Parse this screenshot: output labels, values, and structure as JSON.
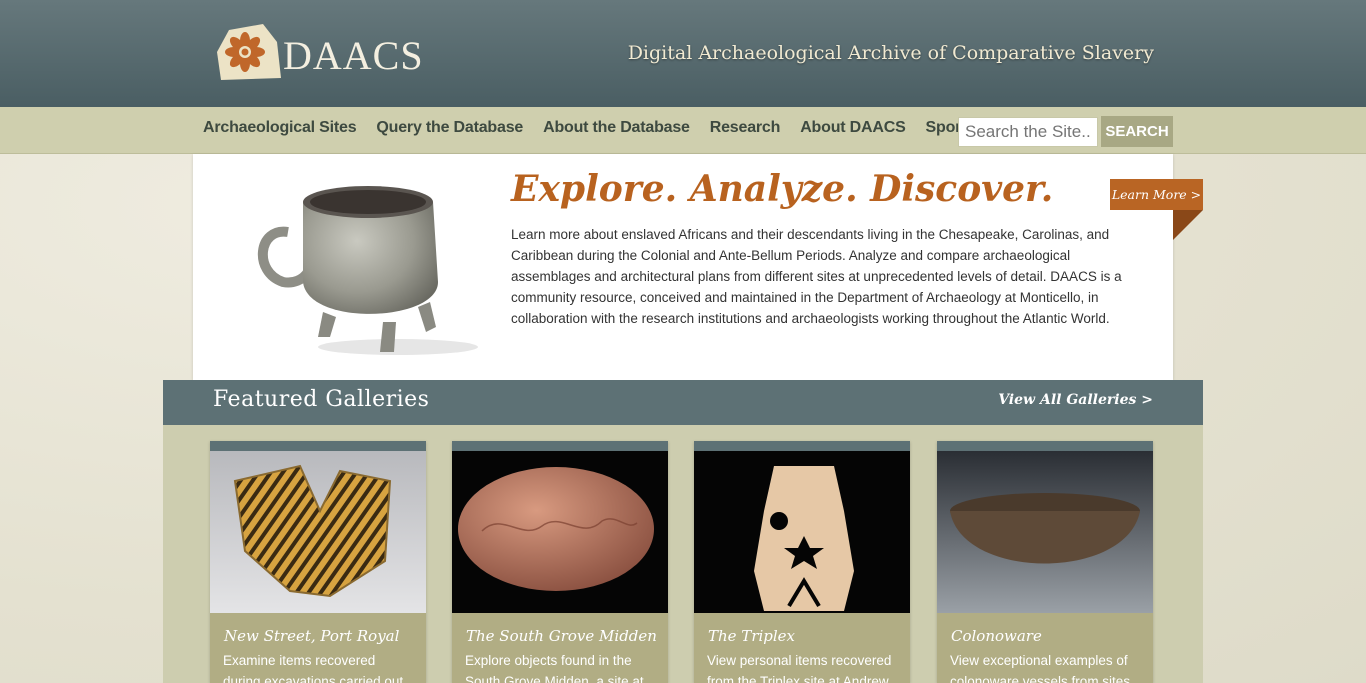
{
  "header": {
    "logo_text": "DAACS",
    "tagline": "Digital Archaeological Archive of Comparative Slavery"
  },
  "nav": {
    "items": [
      {
        "label": "Archaeological Sites"
      },
      {
        "label": "Query the Database"
      },
      {
        "label": "About the Database"
      },
      {
        "label": "Research"
      },
      {
        "label": "About DAACS"
      },
      {
        "label": "Sponsors"
      }
    ],
    "search_placeholder": "Search the Site..",
    "search_button": "SEARCH"
  },
  "hero": {
    "title": "Explore. Analyze. Discover.",
    "body": "Learn more about enslaved Africans and their descendants living in the Chesapeake, Carolinas, and Caribbean during the Colonial and Ante-Bellum Periods. Analyze and compare archaeological assemblages and architectural plans from different sites at unprecedented levels of detail. DAACS is a community resource, conceived and maintained in the Department of Archaeology at Monticello, in collaboration with the research institutions and archaeologists working throughout the Atlantic World.",
    "learn_more": "Learn More >"
  },
  "galleries": {
    "title": "Featured Galleries",
    "view_all": "View All Galleries >",
    "cards": [
      {
        "title": "New Street, Port Royal",
        "desc": "Examine items recovered during excavations carried out at"
      },
      {
        "title": "The South Grove Midden",
        "desc": "Explore objects found in the South Grove Midden, a site at"
      },
      {
        "title": "The Triplex",
        "desc": "View personal items recovered from the Triplex site at Andrew"
      },
      {
        "title": "Colonoware",
        "desc": "View exceptional examples of colonoware vessels from sites"
      }
    ]
  },
  "colors": {
    "header": "#4f6367",
    "nav": "#cfcfae",
    "accent": "#b8621f",
    "gallery_band": "#5d7175",
    "card": "#b1ad84"
  }
}
